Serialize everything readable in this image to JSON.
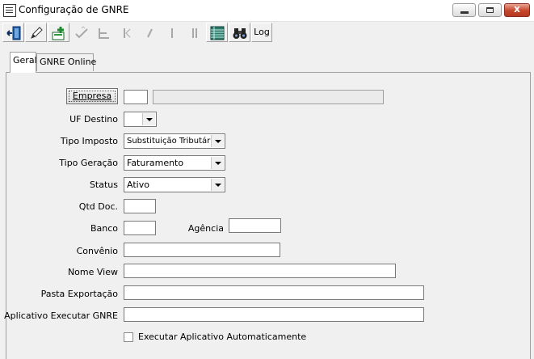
{
  "window": {
    "title": "Configuração de GNRE",
    "controls": {
      "minimize": "–",
      "maximize": "□",
      "close": "x"
    }
  },
  "toolbar": {
    "buttons": [
      {
        "name": "exit",
        "icon": "exit-door-icon",
        "enabled": true
      },
      {
        "name": "edit",
        "icon": "pencil-icon",
        "enabled": true
      },
      {
        "name": "new",
        "icon": "add-record-icon",
        "enabled": true
      },
      {
        "name": "save",
        "icon": "save-check-icon",
        "enabled": false
      },
      {
        "name": "cancel",
        "icon": "cancel-icon",
        "enabled": false
      },
      {
        "name": "first",
        "icon": "first-record-icon",
        "enabled": false
      },
      {
        "name": "prior",
        "icon": "prior-record-icon",
        "enabled": false
      },
      {
        "name": "next",
        "icon": "next-record-icon",
        "enabled": false
      },
      {
        "name": "last",
        "icon": "last-record-icon",
        "enabled": false
      },
      {
        "name": "list",
        "icon": "grid-list-icon",
        "enabled": true
      },
      {
        "name": "find",
        "icon": "binoculars-icon",
        "enabled": true
      }
    ],
    "log_label": "Log"
  },
  "tabs": [
    {
      "label": "Geral",
      "active": true
    },
    {
      "label": "GNRE Online",
      "active": false
    }
  ],
  "form": {
    "empresa_button": "Empresa",
    "empresa_code": "",
    "empresa_name": "",
    "uf_destino_label": "UF Destino",
    "uf_destino_value": "",
    "tipo_imposto_label": "Tipo Imposto",
    "tipo_imposto_value": "Substituição Tributária",
    "tipo_geracao_label": "Tipo Geração",
    "tipo_geracao_value": "Faturamento",
    "status_label": "Status",
    "status_value": "Ativo",
    "qtd_doc_label": "Qtd Doc.",
    "qtd_doc_value": "",
    "banco_label": "Banco",
    "banco_value": "",
    "agencia_label": "Agência",
    "agencia_value": "",
    "convenio_label": "Convênio",
    "convenio_value": "",
    "nome_view_label": "Nome View",
    "nome_view_value": "",
    "pasta_exportacao_label": "Pasta Exportação",
    "pasta_exportacao_value": "",
    "aplicativo_label": "Aplicativo Executar GNRE",
    "aplicativo_value": "",
    "executar_auto_label": "Executar Aplicativo Automaticamente",
    "executar_auto_checked": false
  },
  "colors": {
    "close_button": "#c7452b",
    "panel_bg": "#f0f0f0",
    "disabled_icon": "#a0a0a0"
  }
}
